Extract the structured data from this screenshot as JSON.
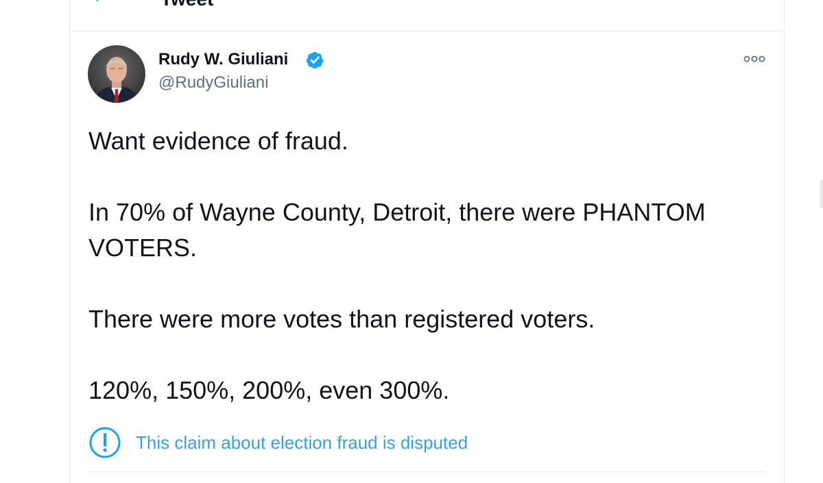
{
  "header": {
    "title": "Tweet"
  },
  "tweet": {
    "author": {
      "display_name": "Rudy W. Giuliani",
      "handle": "@RudyGiuliani",
      "verified": true
    },
    "paragraphs": [
      "Want evidence of fraud.",
      "In 70% of Wayne County, Detroit, there were PHANTOM VOTERS.",
      "There were more votes than registered voters.",
      "120%, 150%, 200%, even 300%."
    ],
    "notice": {
      "icon": "exclamation-circle-icon",
      "text": "This claim about election fraud is disputed"
    }
  },
  "colors": {
    "accent": "#1da1f2",
    "text": "#0f1419",
    "secondary_text": "#5b7083",
    "border": "#e6ecf0"
  }
}
